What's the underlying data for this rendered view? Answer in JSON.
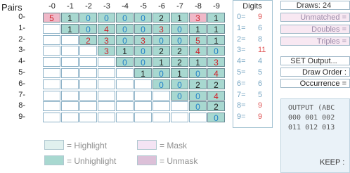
{
  "grid": {
    "title": "Pairs",
    "columns": [
      "-0",
      "-1",
      "-2",
      "-3",
      "-4",
      "-5",
      "-6",
      "-7",
      "-8",
      "-9"
    ],
    "rows": [
      "0-",
      "1-",
      "2-",
      "3-",
      "4-",
      "5-",
      "6-",
      "7-",
      "8-",
      "9-"
    ],
    "cells": [
      [
        [
          "5",
          "red",
          "pink"
        ],
        [
          "1",
          "black",
          "dark"
        ],
        [
          "0",
          "blue",
          "dark"
        ],
        [
          "0",
          "blue",
          "dark"
        ],
        [
          "0",
          "blue",
          "dark"
        ],
        [
          "0",
          "blue",
          "dark"
        ],
        [
          "2",
          "black",
          "dark"
        ],
        [
          "1",
          "black",
          "dark"
        ],
        [
          "3",
          "red",
          "pink"
        ],
        [
          "1",
          "black",
          "dark"
        ]
      ],
      [
        null,
        [
          "1",
          "black",
          "dark"
        ],
        [
          "0",
          "blue",
          "dark"
        ],
        [
          "4",
          "red",
          "dark"
        ],
        [
          "0",
          "blue",
          "dark"
        ],
        [
          "0",
          "blue",
          "dark"
        ],
        [
          "3",
          "red",
          "dark"
        ],
        [
          "0",
          "blue",
          "dark"
        ],
        [
          "1",
          "black",
          "dark"
        ],
        [
          "1",
          "black",
          "dark"
        ]
      ],
      [
        null,
        null,
        [
          "2",
          "red",
          "dark"
        ],
        [
          "3",
          "red",
          "dark"
        ],
        [
          "0",
          "blue",
          "dark"
        ],
        [
          "3",
          "red",
          "dark"
        ],
        [
          "0",
          "blue",
          "dark"
        ],
        [
          "0",
          "blue",
          "dark"
        ],
        [
          "5",
          "red",
          "dark"
        ],
        [
          "1",
          "black",
          "dark"
        ]
      ],
      [
        null,
        null,
        null,
        [
          "3",
          "red",
          "dark"
        ],
        [
          "1",
          "black",
          "dark"
        ],
        [
          "0",
          "blue",
          "dark"
        ],
        [
          "2",
          "black",
          "dark"
        ],
        [
          "2",
          "black",
          "dark"
        ],
        [
          "4",
          "red",
          "dark"
        ],
        [
          "0",
          "blue",
          "dark"
        ]
      ],
      [
        null,
        null,
        null,
        null,
        [
          "0",
          "blue",
          "dark"
        ],
        [
          "0",
          "blue",
          "dark"
        ],
        [
          "1",
          "black",
          "dark"
        ],
        [
          "2",
          "black",
          "dark"
        ],
        [
          "1",
          "black",
          "dark"
        ],
        [
          "3",
          "red",
          "dark"
        ]
      ],
      [
        null,
        null,
        null,
        null,
        null,
        [
          "1",
          "black",
          "dark"
        ],
        [
          "0",
          "blue",
          "dark"
        ],
        [
          "1",
          "black",
          "dark"
        ],
        [
          "0",
          "blue",
          "dark"
        ],
        [
          "4",
          "red",
          "dark"
        ]
      ],
      [
        null,
        null,
        null,
        null,
        null,
        null,
        [
          "0",
          "blue",
          "dark"
        ],
        [
          "0",
          "blue",
          "dark"
        ],
        [
          "2",
          "black",
          "dark"
        ],
        [
          "2",
          "black",
          "dark"
        ]
      ],
      [
        null,
        null,
        null,
        null,
        null,
        null,
        null,
        [
          "0",
          "blue",
          "dark"
        ],
        [
          "0",
          "blue",
          "dark"
        ],
        [
          "4",
          "red",
          "dark"
        ]
      ],
      [
        null,
        null,
        null,
        null,
        null,
        null,
        null,
        null,
        [
          "0",
          "blue",
          "dark"
        ],
        [
          "2",
          "black",
          "dark"
        ]
      ],
      [
        null,
        null,
        null,
        null,
        null,
        null,
        null,
        null,
        null,
        [
          "0",
          "blue",
          "dark"
        ]
      ]
    ]
  },
  "digits": {
    "title": "Digits",
    "items": [
      {
        "label": "0=",
        "count": "9",
        "color": "red"
      },
      {
        "label": "1=",
        "count": "6",
        "color": "blue"
      },
      {
        "label": "2=",
        "count": "8",
        "color": "blue"
      },
      {
        "label": "3=",
        "count": "11",
        "color": "red"
      },
      {
        "label": "4=",
        "count": "4",
        "color": "blue"
      },
      {
        "label": "5=",
        "count": "5",
        "color": "blue"
      },
      {
        "label": "6=",
        "count": "6",
        "color": "blue"
      },
      {
        "label": "7=",
        "count": "5",
        "color": "blue"
      },
      {
        "label": "8=",
        "count": "9",
        "color": "red"
      },
      {
        "label": "9=",
        "count": "9",
        "color": "red"
      }
    ]
  },
  "right_panel": {
    "draws": "Draws: 24",
    "unmatched": "Unmatched =",
    "doubles": "Doubles =",
    "triples": "Triples =",
    "set_output": "SET Output...",
    "draw_order": "Draw Order :",
    "occurrence": "Occurrence =",
    "output_text": "OUTPUT (ABC\n000 001 002\n011 012 013",
    "keep": "KEEP :"
  },
  "legend": {
    "highlight": "= Highlight",
    "unhighlight": "= Unhighlight",
    "mask": "= Mask",
    "unmask": "= Unmask"
  },
  "colors": {
    "highlight": "#e0f0ee",
    "unhighlight": "#a8d8d0",
    "mask": "#f4e4f4",
    "unmask": "#dcc0d8",
    "pink_cell": "#f0b8c8"
  }
}
